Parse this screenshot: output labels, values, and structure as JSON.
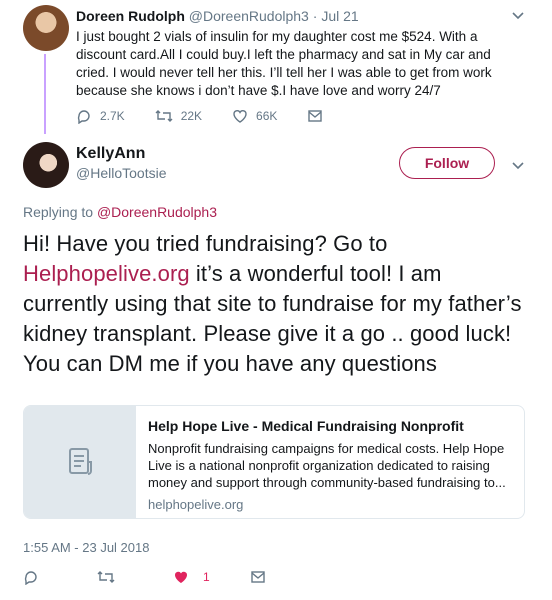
{
  "original_tweet": {
    "name": "Doreen Rudolph",
    "handle": "@DoreenRudolph3",
    "date": "Jul 21",
    "text": "I just bought 2 vials of insulin for my daughter cost me $524. With a discount card.All I could buy.I left the pharmacy and sat in My car and cried. I would never tell her this. I’ll  tell her I was able to get from work because she knows i don’t have $.I have love and worry 24/7",
    "replies": "2.7K",
    "retweets": "22K",
    "likes": "66K"
  },
  "reply_tweet": {
    "name": "KellyAnn",
    "handle": "@HelloTootsie",
    "follow_label": "Follow",
    "replying_to_label": "Replying to",
    "replying_to_handle": "@DoreenRudolph3",
    "text_before_link": "Hi! Have you tried fundraising? Go to ",
    "link_text": "Helphopelive.org",
    "text_after_link": " it’s a wonderful tool! I am currently using that site to fundraise for my father’s kidney transplant. Please give it a go .. good luck! You can DM me if you have any questions",
    "card": {
      "title": "Help Hope Live - Medical Fundraising Nonprofit",
      "description": "Nonprofit fundraising campaigns for medical costs. Help Hope Live is a national nonprofit organization dedicated to raising money and support through community-based fundraising to...",
      "domain": "helphopelive.org"
    },
    "timestamp": "1:55 AM - 23 Jul 2018",
    "like_count": "1"
  },
  "colors": {
    "accent": "#ab1f50",
    "muted": "#657786",
    "like": "#e0245e",
    "thread_line": "#c9a1ff",
    "card_border": "#e1e8ed"
  },
  "icons": {
    "reply": "reply-icon",
    "retweet": "retweet-icon",
    "like": "heart-icon",
    "dm": "envelope-icon",
    "card": "document-icon",
    "menu": "chevron-down-icon"
  }
}
